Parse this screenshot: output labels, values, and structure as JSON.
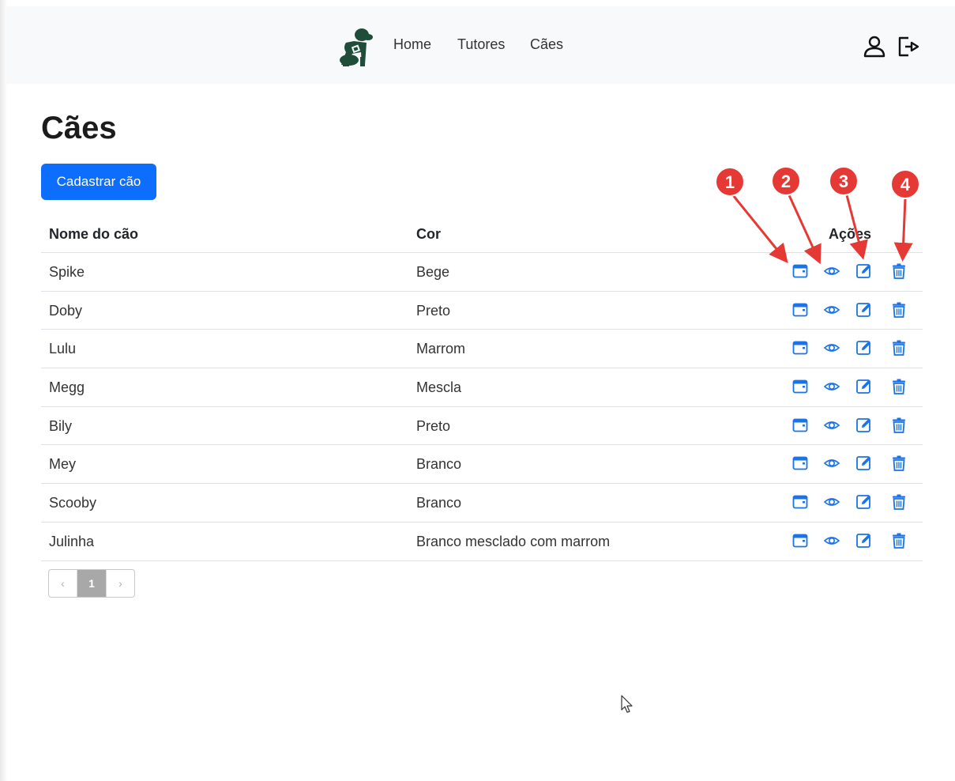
{
  "navbar": {
    "links": [
      "Home",
      "Tutores",
      "Cães"
    ]
  },
  "page": {
    "title": "Cães",
    "add_button": "Cadastrar cão"
  },
  "table": {
    "headers": [
      "Nome do cão",
      "Cor",
      "Ações"
    ],
    "rows": [
      {
        "name": "Spike",
        "color": "Bege"
      },
      {
        "name": "Doby",
        "color": "Preto"
      },
      {
        "name": "Lulu",
        "color": "Marrom"
      },
      {
        "name": "Megg",
        "color": "Mescla"
      },
      {
        "name": "Bily",
        "color": "Preto"
      },
      {
        "name": "Mey",
        "color": "Branco"
      },
      {
        "name": "Scooby",
        "color": "Branco"
      },
      {
        "name": "Julinha",
        "color": "Branco mesclado com marrom"
      }
    ],
    "action_icons": [
      "calendar-icon",
      "eye-icon",
      "edit-icon",
      "trash-icon"
    ]
  },
  "pagination": {
    "prev": "‹",
    "current": "1",
    "next": "›"
  },
  "annotations": {
    "badges": [
      "1",
      "2",
      "3",
      "4"
    ]
  },
  "colors": {
    "primary": "#0d6efd",
    "action_icon": "#1a73e8",
    "annotation": "#e53935",
    "navbar_bg": "#f8f9fa",
    "logo": "#1f4d3a"
  }
}
